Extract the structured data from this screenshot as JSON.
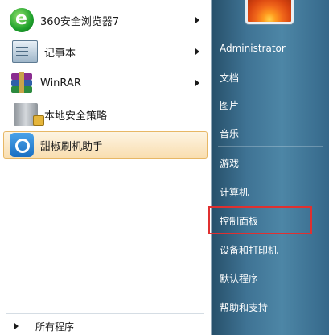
{
  "programs": [
    {
      "label": "360安全浏览器7",
      "icon": "ie-icon",
      "has_submenu": true
    },
    {
      "label": "记事本",
      "icon": "notepad-icon",
      "has_submenu": true
    },
    {
      "label": "WinRAR",
      "icon": "winrar-icon",
      "has_submenu": true
    },
    {
      "label": "本地安全策略",
      "icon": "security-policy-icon",
      "has_submenu": false
    },
    {
      "label": "甜椒刷机助手",
      "icon": "helper-icon",
      "has_submenu": false,
      "highlighted": true
    }
  ],
  "all_programs": "所有程序",
  "right_menu": {
    "user": "Administrator",
    "items": [
      "文档",
      "图片",
      "音乐",
      "游戏",
      "计算机",
      "控制面板",
      "设备和打印机",
      "默认程序",
      "帮助和支持"
    ]
  },
  "colors": {
    "highlight_box": "#e03030",
    "right_pane": "#4d86a6",
    "hover_fill": "#f9deb0"
  }
}
